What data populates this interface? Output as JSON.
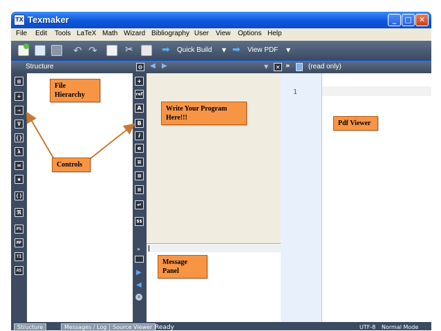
{
  "window": {
    "title": "Texmaker"
  },
  "menu": [
    "File",
    "Edit",
    "Tools",
    "LaTeX",
    "Math",
    "Wizard",
    "Bibliography",
    "User",
    "View",
    "Options",
    "Help"
  ],
  "toolbar": {
    "quick_build": "Quick Build",
    "view_pdf": "View PDF"
  },
  "structure": {
    "title": "Structure"
  },
  "editor": {
    "read_only": "(read only)",
    "line_number": "1"
  },
  "side_icons": [
    "▤",
    "÷",
    "⇒",
    "∇",
    "{}",
    "λ",
    "∞",
    "✱",
    "⟨⟩",
    "ℜ",
    "PS",
    "MP",
    "TI",
    "AS"
  ],
  "symbol_icons": [
    "+",
    "ref",
    "A",
    "B",
    "i",
    "e",
    "≡",
    "≡",
    "≡",
    "↵",
    "$$"
  ],
  "callouts": {
    "file_hierarchy": "File Hierarchy",
    "controls": "Controls",
    "write_program": "Write Your Program Here!!!",
    "message_panel": "Message Panel",
    "pdf_viewer": "Pdf Viewer"
  },
  "status": {
    "tab_structure": "Structure",
    "tab_messages": "Messages / Log",
    "tab_source": "Source Viewer",
    "ready": "Ready",
    "encoding": "UTF-8",
    "mode": "Normal Mode"
  },
  "colors": {
    "callout": "#f79545",
    "titlebar": "#0d58dc",
    "panel_dark": "#3c4b62",
    "editor_bg": "#f0ece0"
  }
}
